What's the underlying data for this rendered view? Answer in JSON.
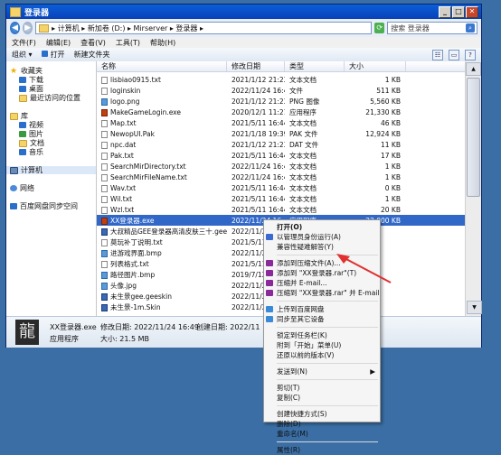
{
  "window": {
    "title": "登录器",
    "buttons": [
      "_",
      "□",
      "✕"
    ]
  },
  "address": {
    "path": "▸ 计算机 ▸ 新加卷 (D:) ▸ Mirserver ▸ 登录器 ▸",
    "search_placeholder": "搜索 登录器"
  },
  "menubar": [
    "文件(F)",
    "编辑(E)",
    "查看(V)",
    "工具(T)",
    "帮助(H)"
  ],
  "toolbar": {
    "organize": "组织 ▾",
    "open": "打开",
    "new_folder": "新建文件夹"
  },
  "nav": {
    "favorites": "收藏夹",
    "fav_items": [
      "下载",
      "桌面",
      "最近访问的位置"
    ],
    "libraries": "库",
    "lib_items": [
      "视频",
      "图片",
      "文档",
      "音乐"
    ],
    "computer": "计算机",
    "network": "网络",
    "baidu": "百度网盘同步空间"
  },
  "columns": [
    "名称",
    "修改日期",
    "类型",
    "大小"
  ],
  "files": [
    {
      "name": "lisbiao0915.txt",
      "date": "2021/1/12 21:23",
      "type": "文本文档",
      "size": "1 KB",
      "icon": "txt"
    },
    {
      "name": "loginskin",
      "date": "2022/11/24 16:49",
      "type": "文件",
      "size": "511 KB",
      "icon": "txt"
    },
    {
      "name": "logo.png",
      "date": "2021/1/12 21:23",
      "type": "PNG 图像",
      "size": "5,560 KB",
      "icon": "img"
    },
    {
      "name": "MakeGameLogin.exe",
      "date": "2020/12/1 11:21",
      "type": "应用程序",
      "size": "21,330 KB",
      "icon": "exe"
    },
    {
      "name": "Map.txt",
      "date": "2021/5/11 16:44",
      "type": "文本文档",
      "size": "46 KB",
      "icon": "txt"
    },
    {
      "name": "NewopUI.Pak",
      "date": "2021/1/18 19:39",
      "type": "PAK 文件",
      "size": "12,924 KB",
      "icon": "txt"
    },
    {
      "name": "npc.dat",
      "date": "2021/1/12 21:23",
      "type": "DAT 文件",
      "size": "11 KB",
      "icon": "txt"
    },
    {
      "name": "Pak.txt",
      "date": "2021/5/11 16:44",
      "type": "文本文档",
      "size": "17 KB",
      "icon": "txt"
    },
    {
      "name": "SearchMirDirectory.txt",
      "date": "2022/11/24 16:49",
      "type": "文本文档",
      "size": "1 KB",
      "icon": "txt"
    },
    {
      "name": "SearchMirFileName.txt",
      "date": "2022/11/24 16:49",
      "type": "文本文档",
      "size": "1 KB",
      "icon": "txt"
    },
    {
      "name": "Wav.txt",
      "date": "2021/5/11 16:44",
      "type": "文本文档",
      "size": "0 KB",
      "icon": "txt"
    },
    {
      "name": "Wil.txt",
      "date": "2021/5/11 16:44",
      "type": "文本文档",
      "size": "1 KB",
      "icon": "txt"
    },
    {
      "name": "Wzl.txt",
      "date": "2021/5/11 16:44",
      "type": "文本文档",
      "size": "20 KB",
      "icon": "txt"
    },
    {
      "name": "XX登录器.exe",
      "date": "2022/11/24 16:49",
      "type": "应用程序",
      "size": "22,000 KB",
      "icon": "exe",
      "selected": true
    },
    {
      "name": "大叔精品GEE登录器高清皮肤三十.geeskin",
      "date": "2022/11/24 16:49",
      "type": "",
      "size": "",
      "icon": "skin"
    },
    {
      "name": "莫玩补丁说明.txt",
      "date": "2021/5/11 16:44",
      "type": "",
      "size": "",
      "icon": "txt"
    },
    {
      "name": "进游戏界面.bmp",
      "date": "2022/11/24 16:49",
      "type": "",
      "size": "",
      "icon": "img"
    },
    {
      "name": "列表格式.txt",
      "date": "2021/5/11 16:44",
      "type": "",
      "size": "",
      "icon": "txt"
    },
    {
      "name": "路径图片.bmp",
      "date": "2019/7/12 16:44",
      "type": "",
      "size": "",
      "icon": "img"
    },
    {
      "name": "头像.jpg",
      "date": "2022/11/24 16:49",
      "type": "",
      "size": "",
      "icon": "img"
    },
    {
      "name": "未生景gee.geeskin",
      "date": "2022/11/24 16:49",
      "type": "",
      "size": "",
      "icon": "skin"
    },
    {
      "name": "未生景-1m.Skin",
      "date": "2022/11/24 16:49",
      "type": "",
      "size": "",
      "icon": "skin"
    }
  ],
  "details": {
    "icon_char": "龍",
    "name": "XX登录器.exe",
    "modified": "修改日期: 2022/11/24 16:49",
    "created": "创建日期: 2022/11/24 16:",
    "type": "应用程序",
    "size": "大小: 21.5 MB"
  },
  "context_menu": [
    {
      "label": "打开(O)",
      "bold": true
    },
    {
      "label": "以管理员身份运行(A)",
      "icon": "#3a6ad0"
    },
    {
      "label": "兼容性疑难解答(Y)"
    },
    {
      "sep": true
    },
    {
      "label": "添加到压缩文件(A)...",
      "icon": "#8a2a9a"
    },
    {
      "label": "添加到 \"XX登录器.rar\"(T)",
      "icon": "#8a2a9a"
    },
    {
      "label": "压缩并 E-mail...",
      "icon": "#8a2a9a"
    },
    {
      "label": "压缩到 \"XX登录器.rar\" 并 E-mail",
      "icon": "#8a2a9a"
    },
    {
      "sep": true
    },
    {
      "label": "上传到百度网盘",
      "icon": "#3a8ad8"
    },
    {
      "label": "同步至其它设备",
      "icon": "#3a8ad8"
    },
    {
      "sep": true
    },
    {
      "label": "锁定到任务栏(K)"
    },
    {
      "label": "附到「开始」菜单(U)"
    },
    {
      "label": "还原以前的版本(V)"
    },
    {
      "sep": true
    },
    {
      "label": "发送到(N)",
      "submenu": true
    },
    {
      "sep": true
    },
    {
      "label": "剪切(T)"
    },
    {
      "label": "复制(C)"
    },
    {
      "sep": true
    },
    {
      "label": "创建快捷方式(S)"
    },
    {
      "label": "删除(D)"
    },
    {
      "label": "重命名(M)"
    },
    {
      "sep": true
    },
    {
      "label": "属性(R)"
    }
  ],
  "annotation_color": "#e03030"
}
